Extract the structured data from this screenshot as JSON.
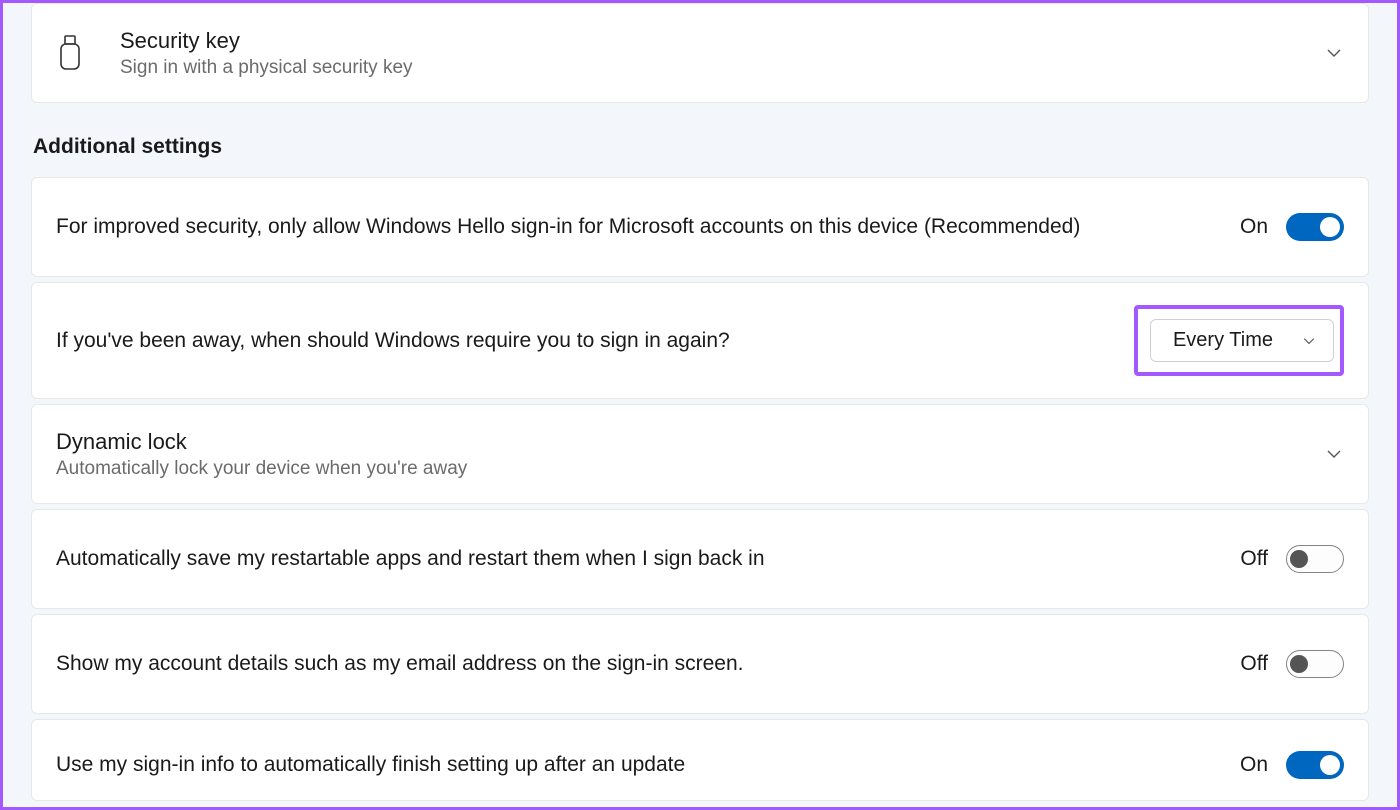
{
  "security_key": {
    "title": "Security key",
    "subtitle": "Sign in with a physical security key"
  },
  "section_heading": "Additional settings",
  "rows": {
    "hello_only": {
      "text": "For improved security, only allow Windows Hello sign-in for Microsoft accounts on this device (Recommended)",
      "state_label": "On",
      "state": "on"
    },
    "require_signin": {
      "text": "If you've been away, when should Windows require you to sign in again?",
      "dropdown_value": "Every Time"
    },
    "dynamic_lock": {
      "title": "Dynamic lock",
      "subtitle": "Automatically lock your device when you're away"
    },
    "restartable_apps": {
      "text": "Automatically save my restartable apps and restart them when I sign back in",
      "state_label": "Off",
      "state": "off"
    },
    "account_details": {
      "text": "Show my account details such as my email address on the sign-in screen.",
      "state_label": "Off",
      "state": "off"
    },
    "finish_setup": {
      "text": "Use my sign-in info to automatically finish setting up after an update",
      "state_label": "On",
      "state": "on"
    }
  }
}
